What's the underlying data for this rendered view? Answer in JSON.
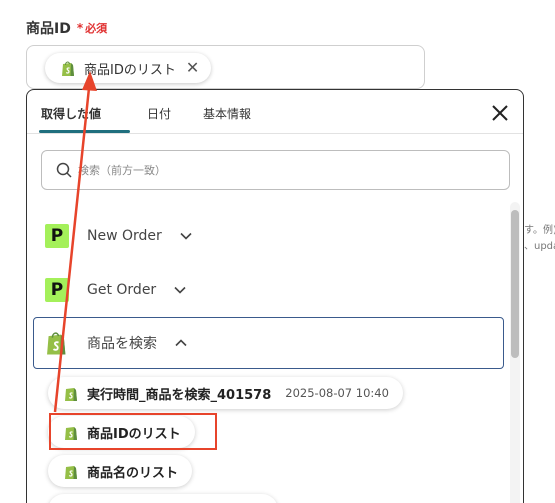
{
  "field": {
    "label": "商品ID",
    "required_star": "*",
    "required_text": "必須",
    "chip_label": "商品IDのリスト"
  },
  "background_text": [
    "す。例)a",
    "、upda"
  ],
  "panel": {
    "tabs": [
      "取得した値",
      "日付",
      "基本情報"
    ],
    "active_tab": "取得した値",
    "search_placeholder": "検索（前方一致）",
    "apps": [
      {
        "name": "New Order",
        "logo": "P",
        "expanded": false
      },
      {
        "name": "Get Order",
        "logo": "P",
        "expanded": false
      },
      {
        "name": "商品を検索",
        "logo": "shopify",
        "expanded": true
      }
    ],
    "results": [
      {
        "label": "実行時間_商品を検索_401578",
        "date": "2025-08-07 10:40"
      },
      {
        "label": "商品IDのリスト",
        "date": ""
      },
      {
        "label": "商品名のリスト",
        "date": ""
      }
    ]
  },
  "colors": {
    "accent": "#1f6f7e",
    "required": "#e03030",
    "highlight": "#e7442b",
    "app_logo_bg": "#a4f05a",
    "shopify_green": "#95bf47",
    "selected_border": "#3a5a8c"
  }
}
